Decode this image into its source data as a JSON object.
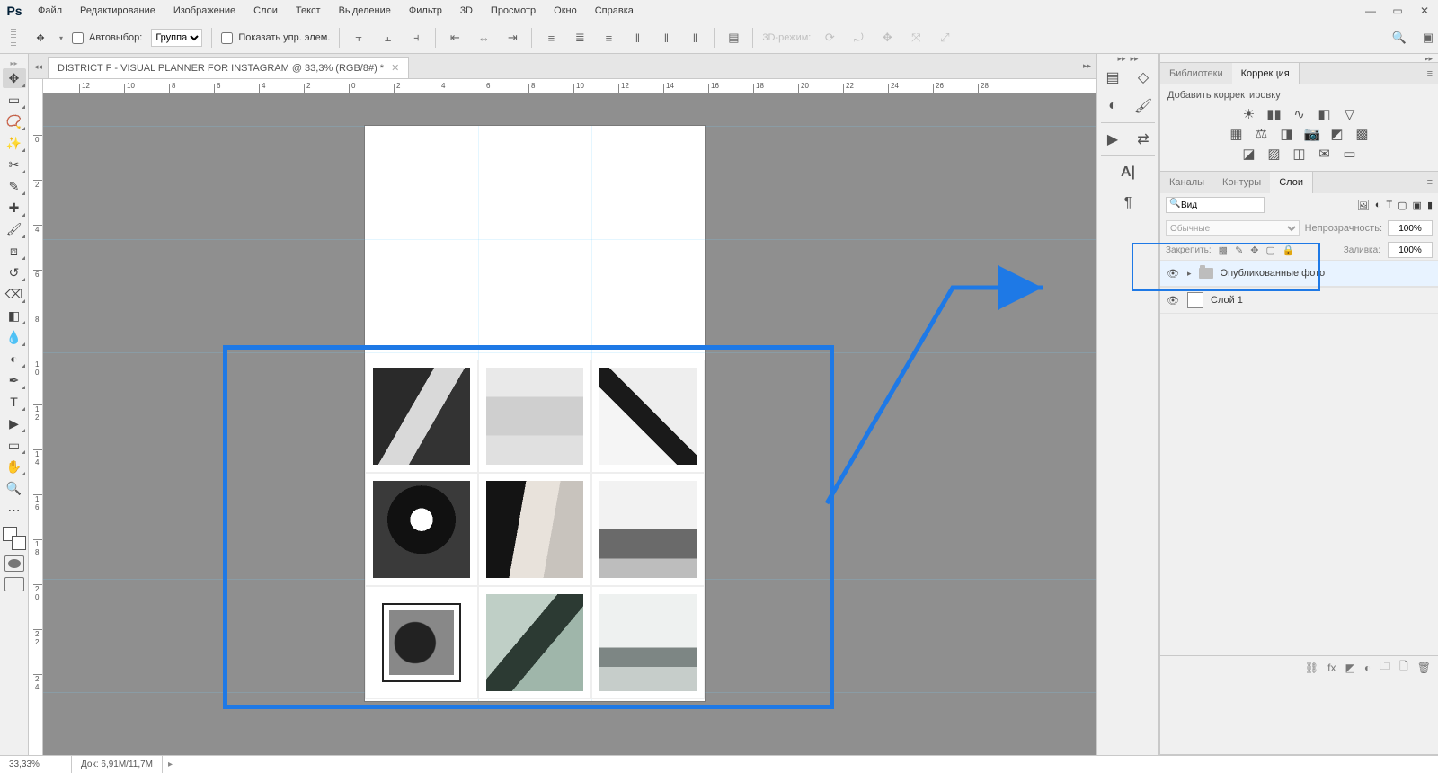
{
  "colors": {
    "annotation": "#1e79e6"
  },
  "menubar": {
    "logo": "Ps",
    "items": [
      "Файл",
      "Редактирование",
      "Изображение",
      "Слои",
      "Текст",
      "Выделение",
      "Фильтр",
      "3D",
      "Просмотр",
      "Окно",
      "Справка"
    ]
  },
  "optbar": {
    "autoselect_label": "Автовыбор:",
    "autoselect_mode": "Группа",
    "show_controls_label": "Показать упр. элем.",
    "threed_label": "3D-режим:"
  },
  "tab": {
    "title": "DISTRICT F -  VISUAL PLANNER FOR INSTAGRAM @ 33,3% (RGB/8#) *"
  },
  "rulers": {
    "h": [
      "12",
      "10",
      "8",
      "6",
      "4",
      "2",
      "0",
      "2",
      "4",
      "6",
      "8",
      "10",
      "12",
      "14",
      "16",
      "18",
      "20",
      "22",
      "24",
      "26",
      "28"
    ],
    "v": [
      "0",
      "2",
      "4",
      "6",
      "8",
      "1 0",
      "1 2",
      "1 4",
      "1 6",
      "1 8",
      "2 0",
      "2 2",
      "2 4"
    ]
  },
  "right": {
    "tabs_top": {
      "libraries": "Библиотеки",
      "adjustments": "Коррекция"
    },
    "adjustments_hint": "Добавить корректировку",
    "tabs_mid": {
      "channels": "Каналы",
      "paths": "Контуры",
      "layers": "Слои"
    },
    "kind_label": "Вид",
    "blend_mode": "Обычные",
    "opacity_label": "Непрозрачность:",
    "opacity_value": "100%",
    "lock_label": "Закрепить:",
    "fill_label": "Заливка:",
    "fill_value": "100%",
    "layers": [
      {
        "name": "Опубликованные фото",
        "type": "group"
      },
      {
        "name": "Слой 1",
        "type": "layer"
      }
    ]
  },
  "status": {
    "zoom": "33,33%",
    "docinfo": "Док: 6,91M/11,7M"
  }
}
